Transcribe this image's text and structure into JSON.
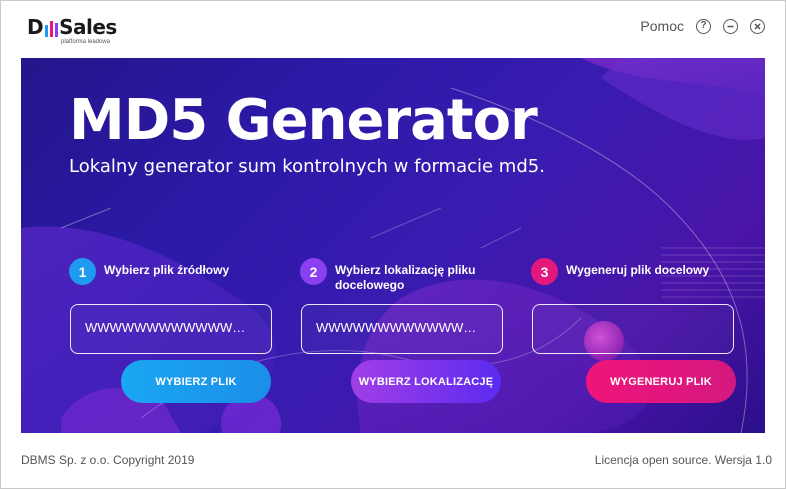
{
  "header": {
    "logo_text_left": "D",
    "logo_text_right": "Sales",
    "logo_subtitle": "platforma leadowa",
    "help_label": "Pomoc",
    "help_icon_glyph": "?"
  },
  "banner": {
    "title": "MD5 Generator",
    "subtitle": "Lokalny generator sum kontrolnych w formacie md5."
  },
  "steps": [
    {
      "num": "1",
      "label": "Wybierz plik źródłowy",
      "field_value": "WWWWWWWWWWWWWWWWWWWWWWWWWW",
      "button": "WYBIERZ PLIK"
    },
    {
      "num": "2",
      "label": "Wybierz lokalizację pliku docelowego",
      "field_value": "WWWWWWWWWWWWWWWWWWWWWWWWWW",
      "button": "WYBIERZ LOKALIZACJĘ"
    },
    {
      "num": "3",
      "label": "Wygeneruj plik docelowy",
      "field_value": "",
      "button": "WYGENERUJ PLIK"
    }
  ],
  "footer": {
    "copyright": "DBMS Sp. z o.o. Copyright 2019",
    "license": "Licencja open source.  Wersja 1.0"
  },
  "colors": {
    "step1": "#1e9bf0",
    "step2": "#8a3ff0",
    "step3": "#e3187d",
    "logo_bar1": "#1e9bf0",
    "logo_bar2": "#e3187d",
    "logo_bar3": "#8a3ff0"
  }
}
